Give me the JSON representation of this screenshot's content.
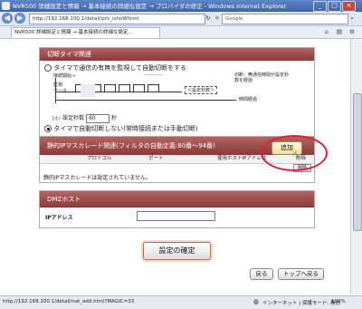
{
  "window": {
    "title": "NVR500 詳細設定と情報 → 基本接続の詳細な設定 → プロバイダの修正 - Windows Internet Explorer",
    "min": "_",
    "max": "□",
    "close": "×"
  },
  "address_bar": {
    "back": "◀",
    "forward": "▶",
    "url": "http://192.168.100.1/detail/prv_ishoWhtml",
    "search_placeholder": "Google"
  },
  "tab": {
    "label": "NVR500 詳細設定と情報 → 基本接続の詳細な設定..."
  },
  "timer_section": {
    "header": "切断タイマ関連",
    "option_monitor": "タイマで通信の有無を監視して自動切断をする",
    "diagram": {
      "connect_req": "接続開始→",
      "dash": "------------",
      "cut_note": "切断：無通信時間が設定秒数を経過",
      "monitor": "監視",
      "data": "データ",
      "set_seconds": "＜設定秒数＞",
      "elapsed": "時間経過"
    },
    "setting_label": "▷▷ 設定秒数",
    "setting_value": "60",
    "setting_unit": "秒",
    "option_no_auto": "タイマで自動切断しない(常時接続または手動切断)"
  },
  "static_ip_section": {
    "header": "静的IPマスカレード関連(フィルタの自動定義:80番〜94番)",
    "add_button": "追加",
    "columns": [
      "プロトコル",
      "ポート",
      "使用ホストIPアドレス",
      "削除"
    ],
    "small_button": "削除",
    "empty_message": "静的IPマスカレードは設定されていません。"
  },
  "dmz_section": {
    "header": "DMZホスト",
    "ip_label": "IPアドレス",
    "ip_value": ""
  },
  "confirm_button": "設定の確定",
  "back_button": "戻る",
  "top_button": "トップへ戻る",
  "status_bar": {
    "url": "http://192.168.100.1/detail/nat_add.html?MAGIC=33",
    "zone": "インターネット | 保護モード: 無効",
    "zoom": "100%"
  },
  "colors": {
    "panel_header": "#9b4747",
    "highlight_circle": "#e0203a"
  }
}
